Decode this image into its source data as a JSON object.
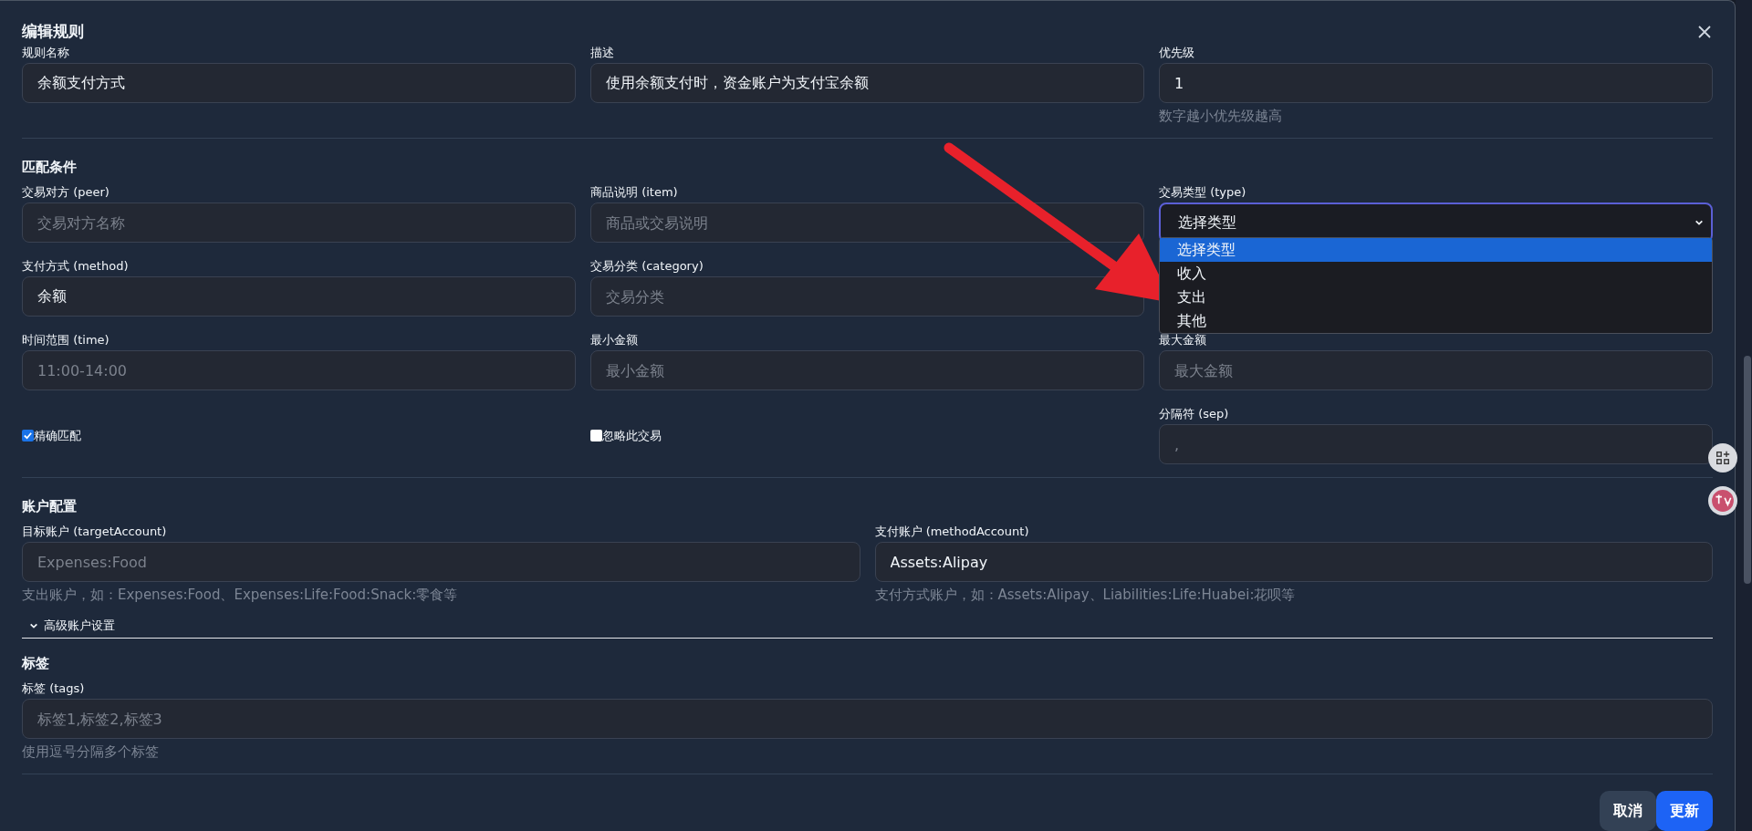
{
  "dialog": {
    "title": "编辑规则"
  },
  "basic_fields": [
    {
      "kind": "text",
      "label": "规则名称",
      "value": "余额支付方式"
    },
    {
      "kind": "text",
      "label": "描述",
      "value": "使用余额支付时，资金账户为支付宝余额"
    },
    {
      "kind": "text",
      "label": "优先级",
      "value": "1",
      "hint": "数字越小优先级越高"
    }
  ],
  "match_conditions": {
    "heading": "匹配条件",
    "fields": [
      {
        "kind": "text",
        "label": "交易对方 (peer)",
        "placeholder": "交易对方名称"
      },
      {
        "kind": "text",
        "label": "商品说明 (item)",
        "placeholder": "商品或交易说明"
      },
      {
        "kind": "select",
        "label": "交易类型 (type)",
        "value": "选择类型",
        "expanded": true,
        "options": [
          {
            "label": "选择类型",
            "selected": true
          },
          {
            "label": "收入",
            "selected": false
          },
          {
            "label": "支出",
            "selected": false
          },
          {
            "label": "其他",
            "selected": false
          }
        ]
      },
      {
        "kind": "text",
        "label": "支付方式 (method)",
        "value": "余额"
      },
      {
        "kind": "text",
        "label": "交易分类 (category)",
        "placeholder": "交易分类"
      },
      {
        "kind": "text",
        "label": "时间范围 (time)",
        "placeholder": "11:00-14:00"
      },
      {
        "kind": "text",
        "label": "最小金额",
        "placeholder": "最小金额"
      },
      {
        "kind": "text",
        "label": "最大金额",
        "placeholder": "最大金额"
      },
      {
        "kind": "checkbox",
        "label": "精确匹配",
        "checked": true
      },
      {
        "kind": "checkbox",
        "label": "忽略此交易",
        "checked": false
      },
      {
        "kind": "text",
        "label": "分隔符 (sep)",
        "placeholder": ","
      }
    ]
  },
  "account_config": {
    "heading": "账户配置",
    "fields": [
      {
        "kind": "text",
        "label": "目标账户 (targetAccount)",
        "placeholder": "Expenses:Food",
        "hint": "支出账户，如：Expenses:Food、Expenses:Life:Food:Snack:零食等"
      },
      {
        "kind": "text",
        "label": "支付账户 (methodAccount)",
        "value": "Assets:Alipay",
        "hint": "支付方式账户，如：Assets:Alipay、Liabilities:Life:Huabei:花呗等"
      }
    ],
    "advanced": {
      "label": "高级账户设置",
      "expanded": false
    }
  },
  "tags": {
    "heading": "标签",
    "fields": [
      {
        "kind": "text",
        "label": "标签 (tags)",
        "placeholder": "标签1,标签2,标签3",
        "hint": "使用逗号分隔多个标签"
      }
    ]
  },
  "buttons": [
    {
      "label": "取消",
      "kind": "secondary"
    },
    {
      "label": "更新",
      "kind": "primary"
    }
  ]
}
